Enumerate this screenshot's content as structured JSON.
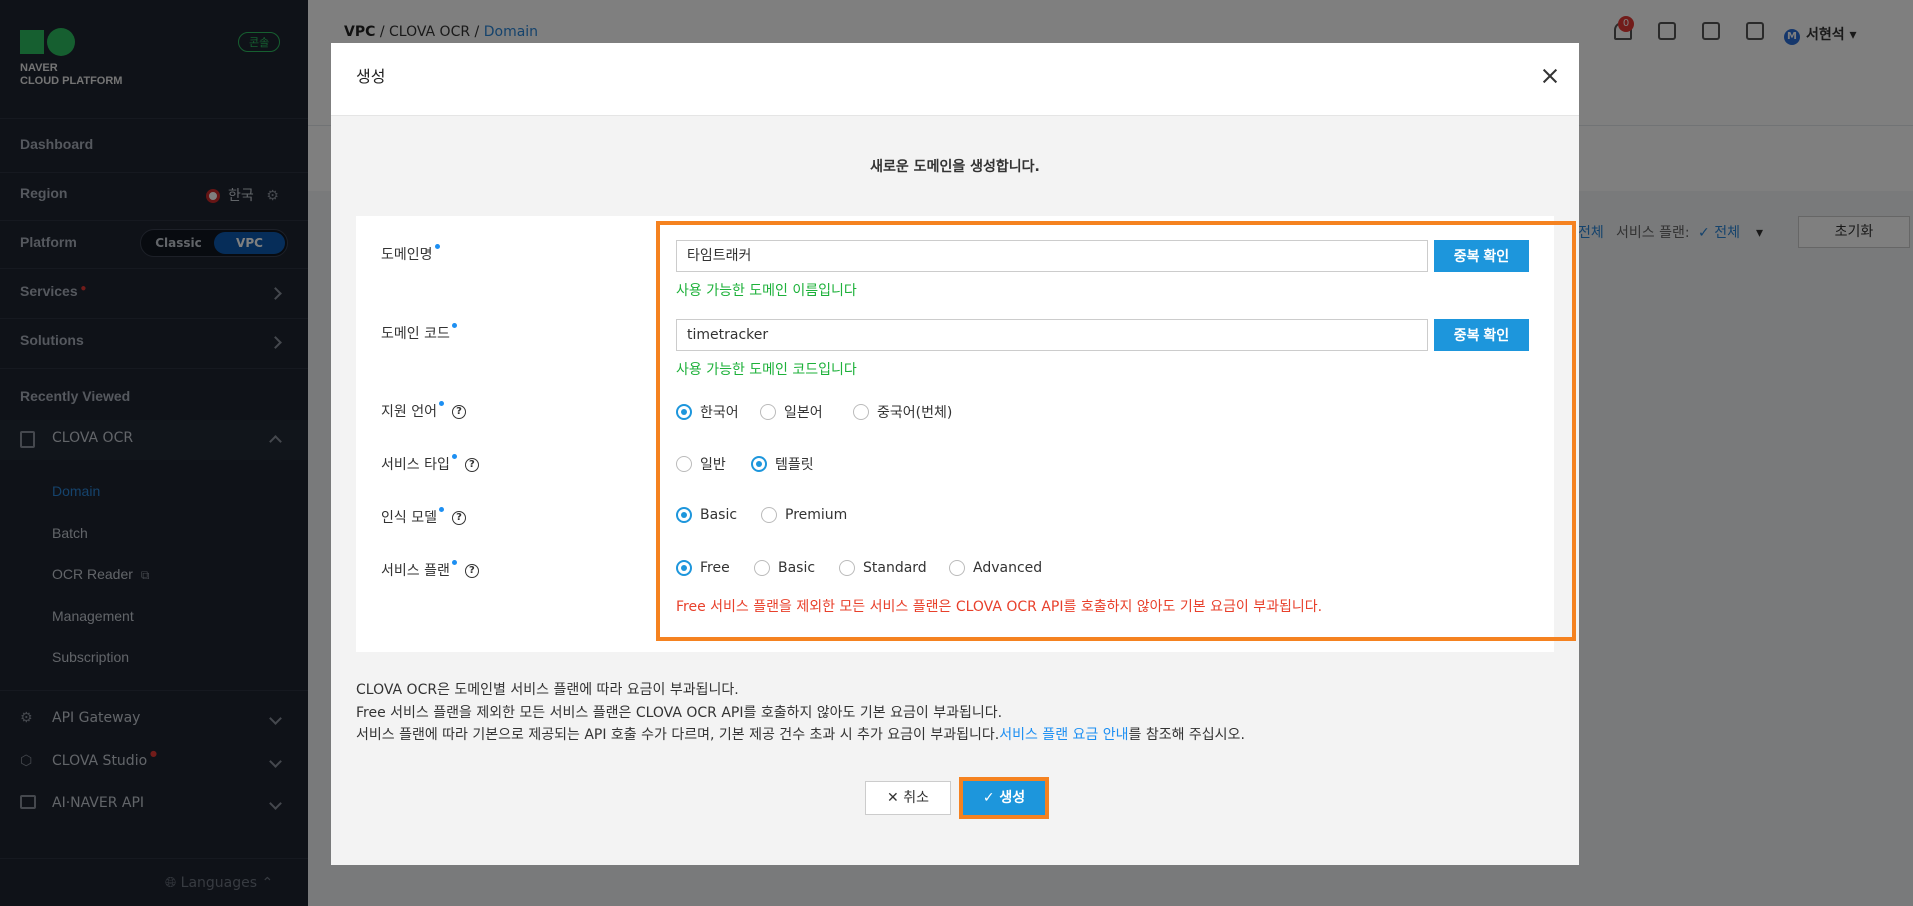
{
  "sidebar": {
    "logo_line1": "NAVER",
    "logo_line2": "CLOUD PLATFORM",
    "console_badge": "콘솔",
    "dashboard": "Dashboard",
    "region_label": "Region",
    "region_value": "한국",
    "platform_label": "Platform",
    "platform_classic": "Classic",
    "platform_vpc": "VPC",
    "services": "Services",
    "solutions": "Solutions",
    "recently_viewed": "Recently Viewed",
    "clova_ocr": "CLOVA OCR",
    "sub": [
      "Domain",
      "Batch",
      "OCR Reader",
      "Management",
      "Subscription"
    ],
    "api_gateway": "API Gateway",
    "clova_studio": "CLOVA Studio",
    "ai_naver_api": "AI·NAVER API",
    "languages": "Languages"
  },
  "header": {
    "crumb1": "VPC",
    "crumb2": "CLOVA OCR",
    "crumb3": "Domain",
    "bell_count": "0",
    "user_initial": "M",
    "user_name": "서현석"
  },
  "filter": {
    "all1": "전체",
    "plan_label": "서비스 플랜:",
    "plan_value": "전체",
    "reset": "초기화"
  },
  "modal": {
    "title": "생성",
    "intro": "새로운 도메인을 생성합니다.",
    "domain_name_label": "도메인명",
    "domain_name_value": "타임트래커",
    "dup_check": "중복 확인",
    "domain_name_ok": "사용 가능한 도메인 이름입니다",
    "domain_code_label": "도메인 코드",
    "domain_code_value": "timetracker",
    "domain_code_ok": "사용 가능한 도메인 코드입니다",
    "lang_label": "지원 언어",
    "lang_options": [
      "한국어",
      "일본어",
      "중국어(번체)"
    ],
    "service_type_label": "서비스 타입",
    "service_type_options": [
      "일반",
      "템플릿"
    ],
    "model_label": "인식 모델",
    "model_options": [
      "Basic",
      "Premium"
    ],
    "plan_label": "서비스 플랜",
    "plan_options": [
      "Free",
      "Basic",
      "Standard",
      "Advanced"
    ],
    "warning": "Free 서비스 플랜을 제외한 모든 서비스 플랜은 CLOVA OCR API를 호출하지 않아도 기본 요금이 부과됩니다.",
    "note1": "CLOVA OCR은 도메인별 서비스 플랜에 따라 요금이 부과됩니다.",
    "note2": "Free 서비스 플랜을 제외한 모든 서비스 플랜은 CLOVA OCR API를 호출하지 않아도 기본 요금이 부과됩니다.",
    "note3_pre": "서비스 플랜에 따라 기본으로 제공되는 API 호출 수가 다르며, 기본 제공 건수 초과 시 추가 요금이 부과됩니다.",
    "note3_link": "서비스 플랜 요금 안내",
    "note3_post": "를 참조해 주십시오.",
    "cancel": "취소",
    "create": "생성"
  },
  "colors": {
    "accent": "#1d96dc",
    "highlight": "#f58220",
    "ok": "#1db13a",
    "warn": "#e8402b"
  }
}
